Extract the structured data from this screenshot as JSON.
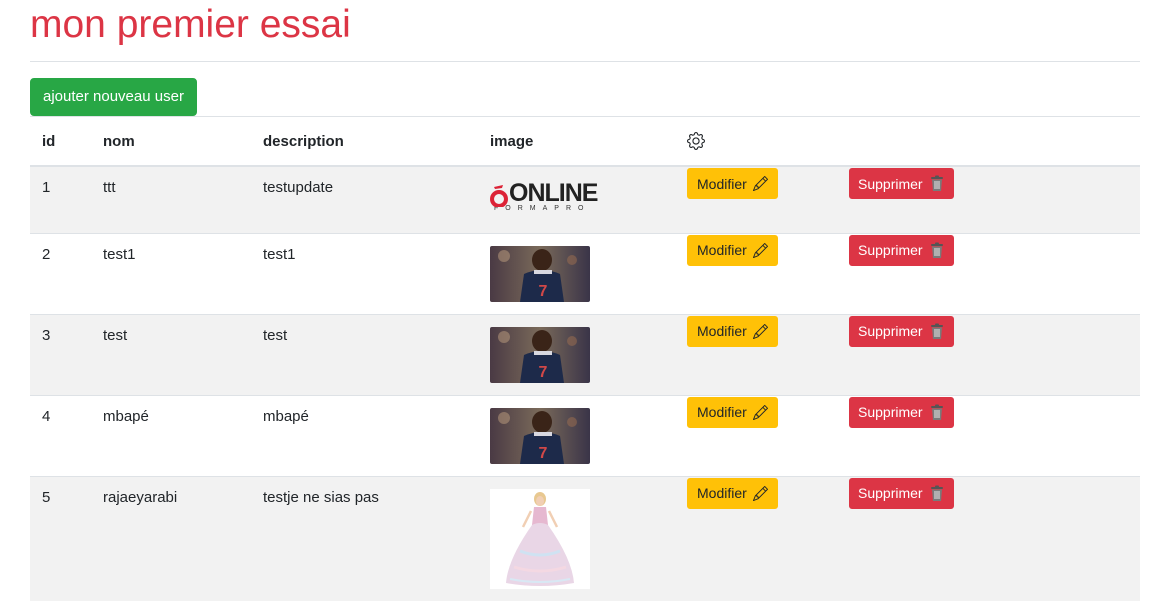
{
  "page": {
    "title": "mon premier essai",
    "add_button": "ajouter nouveau user"
  },
  "table": {
    "headers": {
      "id": "id",
      "nom": "nom",
      "description": "description",
      "image": "image",
      "actions_icon": "gear-icon"
    },
    "rows": [
      {
        "id": "1",
        "nom": "ttt",
        "description": "testupdate",
        "image": "online-formapro-logo",
        "logo_text": "ONLINE",
        "logo_sub": "FORMAPRO"
      },
      {
        "id": "2",
        "nom": "test1",
        "description": "test1",
        "image": "football-player-photo"
      },
      {
        "id": "3",
        "nom": "test",
        "description": "test",
        "image": "football-player-photo"
      },
      {
        "id": "4",
        "nom": "mbapé",
        "description": "mbapé",
        "image": "football-player-photo"
      },
      {
        "id": "5",
        "nom": "rajaeyarabi",
        "description": "testje ne sias pas",
        "image": "doll-gown-photo"
      }
    ],
    "modify_label": "Modifier",
    "delete_label": "Supprimer"
  },
  "colors": {
    "title": "#dc3545",
    "add_button": "#28a745",
    "modify_button": "#ffc107",
    "delete_button": "#dc3545",
    "striped_row": "#f2f2f2"
  },
  "icons": {
    "modify": "pencil-icon",
    "delete": "trash-icon",
    "header": "gear-icon"
  }
}
